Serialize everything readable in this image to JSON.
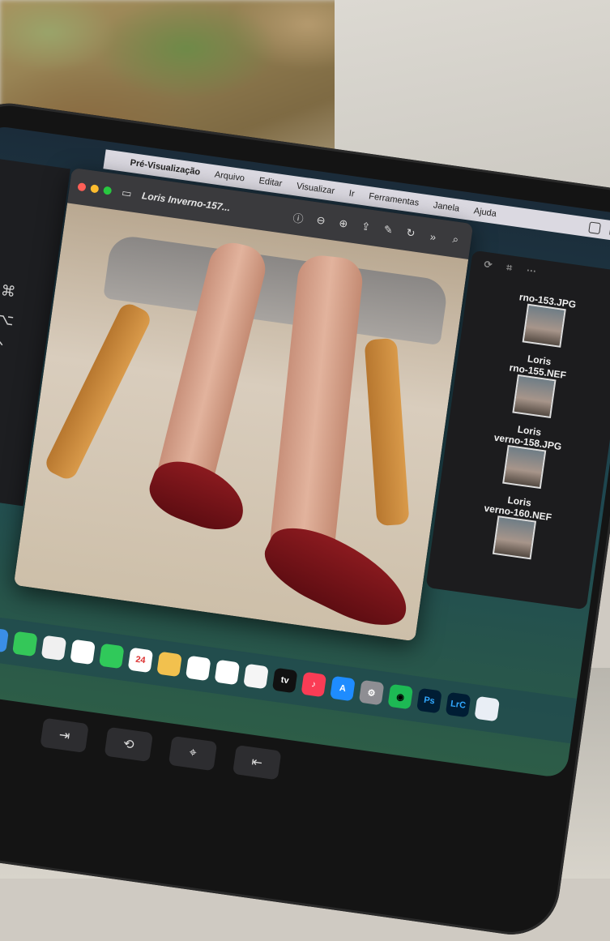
{
  "menubar": {
    "apple": "",
    "app_name": "Pré-Visualização",
    "items": [
      "Arquivo",
      "Editar",
      "Visualizar",
      "Ir",
      "Ferramentas",
      "Janela",
      "Ajuda"
    ]
  },
  "rail": {
    "keys": [
      "⌘",
      "⌥",
      "⌃",
      "⇧"
    ]
  },
  "preview": {
    "title": "Loris Inverno-157...",
    "more_glyph": "»"
  },
  "thumbnails": [
    {
      "label": "rno-153.JPG"
    },
    {
      "label": "Loris\nrno-155.NEF"
    },
    {
      "label": "Loris\nverno-158.JPG"
    },
    {
      "label": "Loris\nverno-160.NEF"
    }
  ],
  "dock": {
    "calendar_day": "24",
    "tv_label": "tv",
    "ps_label": "Ps",
    "lrc_label": "LrC"
  },
  "keyboard_bar": {
    "keys": [
      "⇥",
      "⟲",
      "⌖",
      "⇤"
    ]
  }
}
